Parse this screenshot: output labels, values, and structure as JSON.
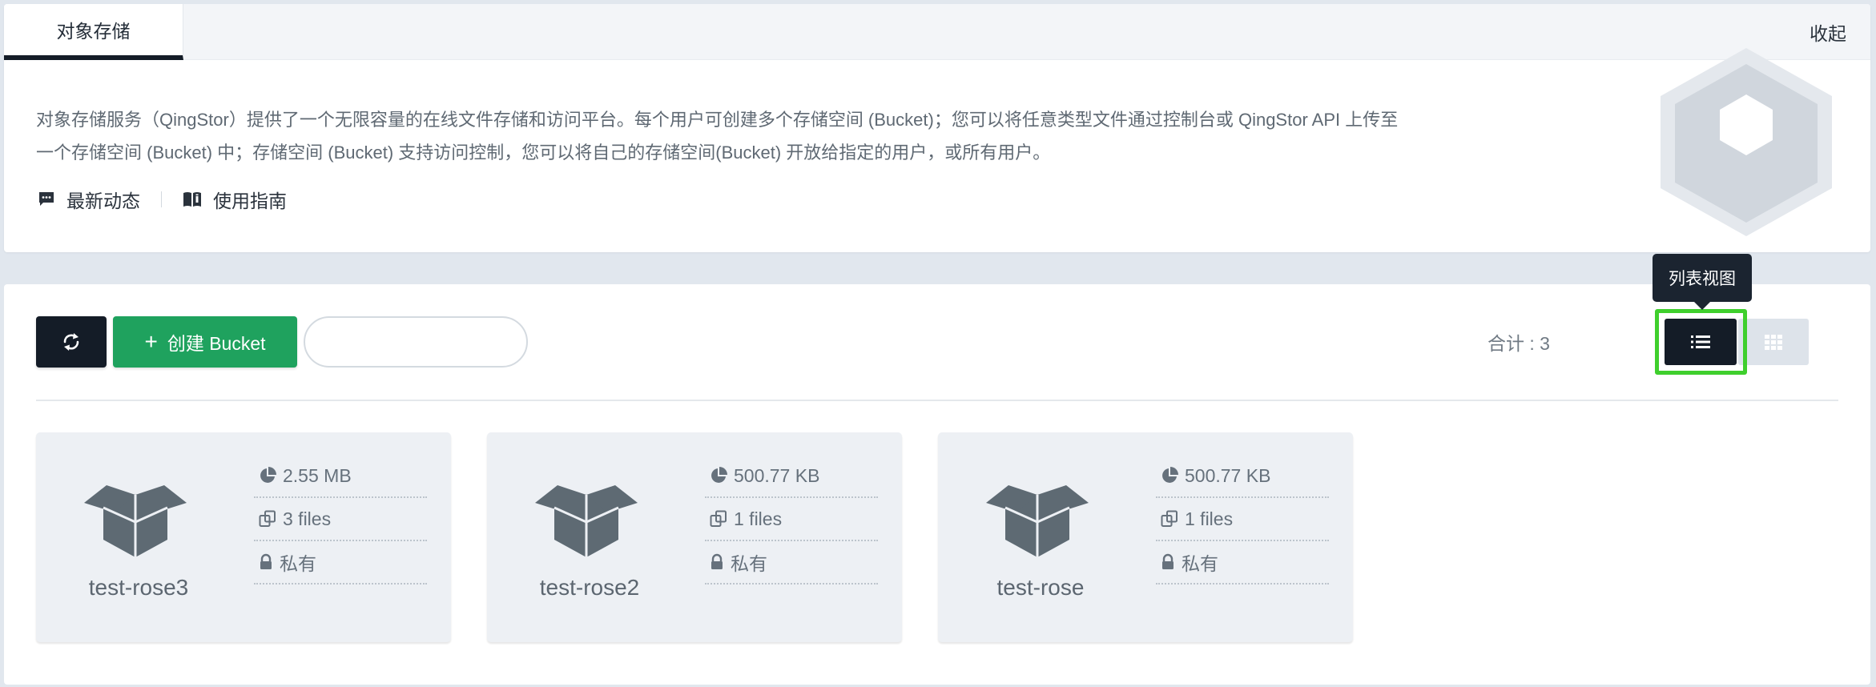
{
  "header": {
    "tab_label": "对象存储",
    "collapse_label": "收起"
  },
  "intro": {
    "description_line1": "对象存储服务（QingStor）提供了一个无限容量的在线文件存储和访问平台。每个用户可创建多个存储空间 (Bucket)；您可以将任意类型文件通过控制台或 QingStor API 上传至",
    "description_line2": "一个存储空间 (Bucket) 中；存储空间 (Bucket) 支持访问控制，您可以将自己的存储空间(Bucket) 开放给指定的用户，或所有用户。",
    "links": [
      {
        "label": "最新动态",
        "icon": "message-icon"
      },
      {
        "label": "使用指南",
        "icon": "book-icon"
      }
    ]
  },
  "toolbar": {
    "refresh_icon": "refresh-icon",
    "create_plus": "+",
    "create_label": "创建 Bucket",
    "search_value": "",
    "search_placeholder": "",
    "total_label": "合计 : 3",
    "list_view_tooltip": "列表视图",
    "view_mode_selected": "list-view"
  },
  "buckets": [
    {
      "name": "test-rose3",
      "size": "2.55 MB",
      "files": "3 files",
      "access": "私有"
    },
    {
      "name": "test-rose2",
      "size": "500.77 KB",
      "files": "1 files",
      "access": "私有"
    },
    {
      "name": "test-rose",
      "size": "500.77 KB",
      "files": "1 files",
      "access": "私有"
    }
  ],
  "colors": {
    "dark": "#141c27",
    "accent_green": "#1fa25e",
    "highlight_green": "#3fcf2d",
    "card_bg": "#edf0f4",
    "page_bg": "#e1e7ee"
  }
}
